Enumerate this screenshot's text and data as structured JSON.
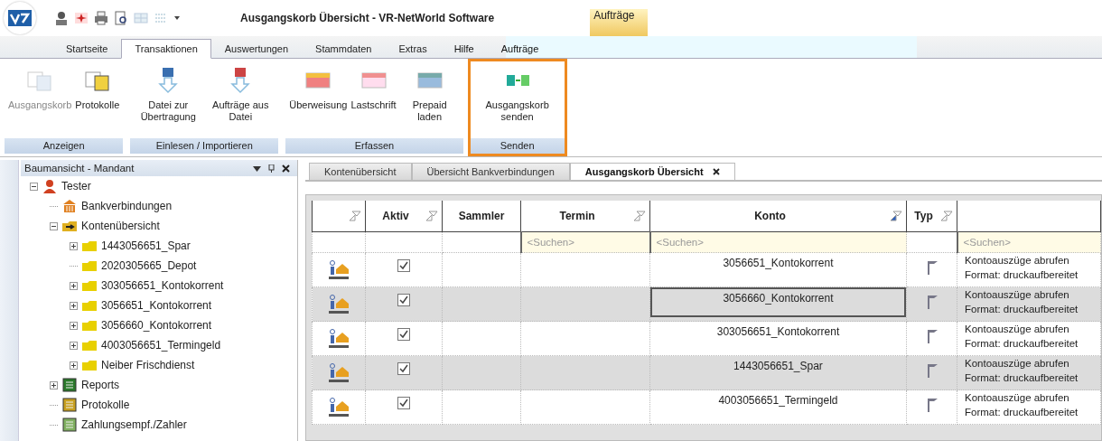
{
  "window": {
    "title": "Ausgangskorb Übersicht - VR-NetWorld Software",
    "context_tab": "Aufträge"
  },
  "ribbon_tabs": [
    {
      "label": "Startseite",
      "selected": false,
      "contextual": false
    },
    {
      "label": "Transaktionen",
      "selected": true,
      "contextual": false
    },
    {
      "label": "Auswertungen",
      "selected": false,
      "contextual": false
    },
    {
      "label": "Stammdaten",
      "selected": false,
      "contextual": false
    },
    {
      "label": "Extras",
      "selected": false,
      "contextual": false
    },
    {
      "label": "Hilfe",
      "selected": false,
      "contextual": true
    },
    {
      "label": "Aufträge",
      "selected": false,
      "contextual": true
    }
  ],
  "ribbon_groups": [
    {
      "label": "Anzeigen",
      "highlighted": false,
      "buttons": [
        {
          "label": "Ausgangskorb",
          "kind": "outbox",
          "disabled": true
        },
        {
          "label": "Protokolle",
          "kind": "log",
          "disabled": false
        }
      ]
    },
    {
      "label": "Einlesen / Importieren",
      "highlighted": false,
      "buttons": [
        {
          "label": "Datei zur Übertragung",
          "kind": "fileimport",
          "disabled": false
        },
        {
          "label": "Aufträge aus Datei",
          "kind": "orderimport",
          "disabled": false
        }
      ]
    },
    {
      "label": "Erfassen",
      "highlighted": false,
      "buttons": [
        {
          "label": "Überweisung",
          "kind": "transfer",
          "disabled": false
        },
        {
          "label": "Lastschrift",
          "kind": "debit",
          "disabled": false
        },
        {
          "label": "Prepaid laden",
          "kind": "prepaid",
          "disabled": false
        }
      ]
    },
    {
      "label": "Senden",
      "highlighted": true,
      "buttons": [
        {
          "label": "Ausgangskorb senden",
          "kind": "send",
          "disabled": false
        }
      ]
    }
  ],
  "tree_panel": {
    "title": "Baumansicht - Mandant",
    "items": [
      {
        "label": "Tester",
        "kind": "person",
        "expanded": true,
        "children": [
          {
            "label": "Bankverbindungen",
            "kind": "bank"
          },
          {
            "label": "Kontenübersicht",
            "kind": "accounts",
            "expanded": true,
            "children": [
              {
                "label": "1443056651_Spar",
                "kind": "folder",
                "expanded": false
              },
              {
                "label": "2020305665_Depot",
                "kind": "folder"
              },
              {
                "label": "303056651_Kontokorrent",
                "kind": "folder",
                "expanded": false
              },
              {
                "label": "3056651_Kontokorrent",
                "kind": "folder",
                "expanded": false
              },
              {
                "label": "3056660_Kontokorrent",
                "kind": "folder",
                "expanded": false
              },
              {
                "label": "4003056651_Termingeld",
                "kind": "folder",
                "expanded": false
              },
              {
                "label": "Neiber Frischdienst",
                "kind": "folder",
                "expanded": false
              }
            ]
          },
          {
            "label": "Reports",
            "kind": "reports",
            "expanded": false
          },
          {
            "label": "Protokolle",
            "kind": "log"
          },
          {
            "label": "Zahlungsempf./Zahler",
            "kind": "payee"
          }
        ]
      }
    ]
  },
  "document_tabs": [
    {
      "label": "Kontenübersicht",
      "selected": false
    },
    {
      "label": "Übersicht Bankverbindungen",
      "selected": false
    },
    {
      "label": "Ausgangskorb Übersicht",
      "selected": true
    }
  ],
  "table": {
    "columns": [
      {
        "filter": true,
        "sorted": false
      },
      {
        "label": "Aktiv",
        "filter": true,
        "sorted": false
      },
      {
        "label": "Sammler",
        "filter": false,
        "sorted": false
      },
      {
        "label": "Termin",
        "filter": true,
        "sorted": false,
        "placeholder": "<Suchen>"
      },
      {
        "label": "Konto",
        "filter": true,
        "sorted": true,
        "placeholder": "<Suchen>"
      },
      {
        "label": "Typ",
        "filter": true,
        "sorted": false
      },
      {
        "filter": false,
        "sorted": false,
        "placeholder": "<Suchen>"
      }
    ],
    "rows": [
      {
        "selected": false,
        "active": true,
        "konto": "3056651_Kontokorrent",
        "auftrag": [
          "Kontoauszüge abrufen",
          "Format: druckaufbereitet"
        ]
      },
      {
        "selected": true,
        "active": true,
        "konto": "3056660_Kontokorrent",
        "auftrag": [
          "Kontoauszüge abrufen",
          "Format: druckaufbereitet"
        ]
      },
      {
        "selected": false,
        "active": true,
        "konto": "303056651_Kontokorrent",
        "auftrag": [
          "Kontoauszüge abrufen",
          "Format: druckaufbereitet"
        ]
      },
      {
        "selected": false,
        "active": true,
        "konto": "1443056651_Spar",
        "auftrag": [
          "Kontoauszüge abrufen",
          "Format: druckaufbereitet"
        ]
      },
      {
        "selected": false,
        "active": true,
        "konto": "4003056651_Termingeld",
        "auftrag": [
          "Kontoauszüge abrufen",
          "Format: druckaufbereitet"
        ]
      }
    ]
  }
}
